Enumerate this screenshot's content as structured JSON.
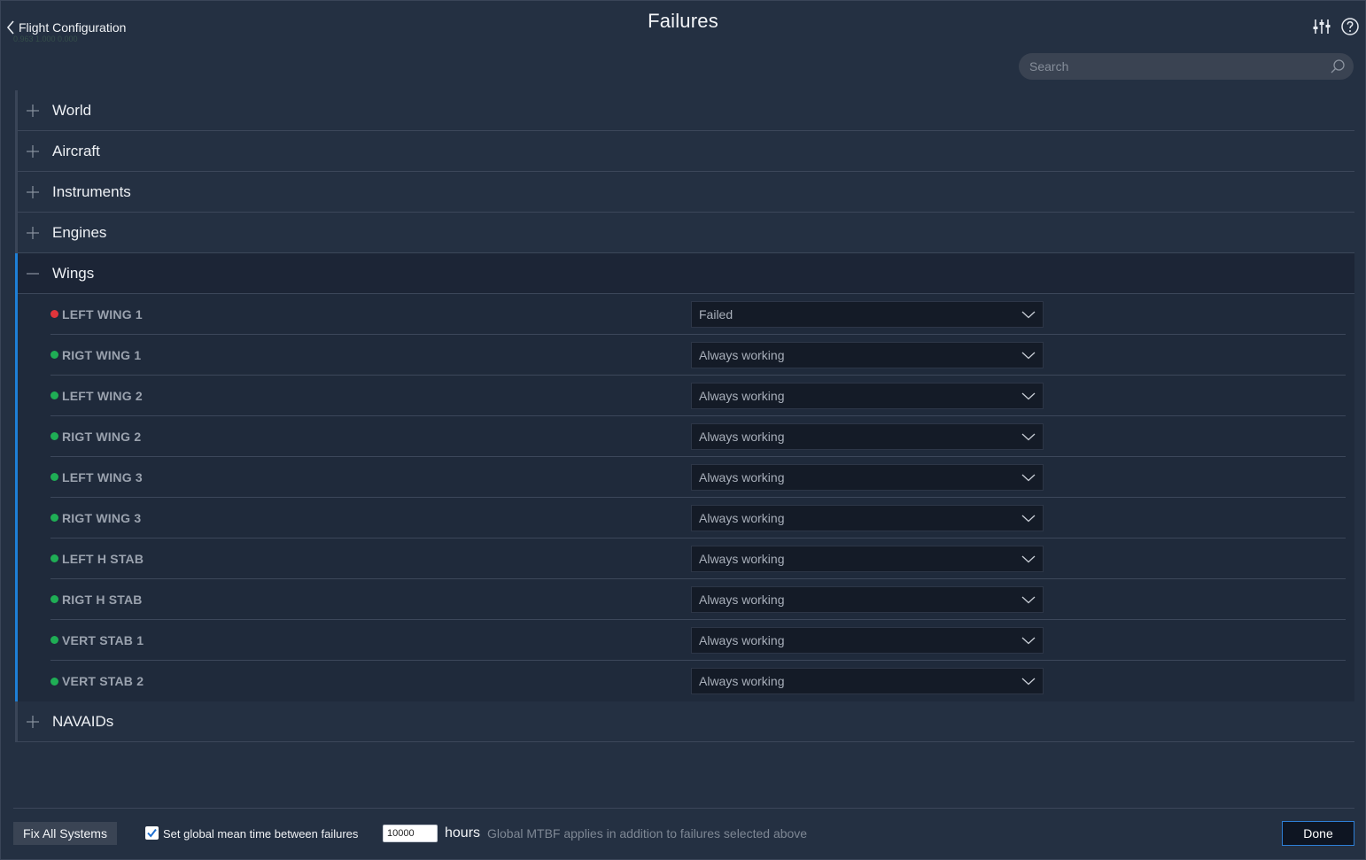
{
  "header": {
    "back_label": "Flight Configuration",
    "title": "Failures",
    "filter_icon": "sliders-icon",
    "help_icon": "help-circle-icon",
    "ghost_text": "0.963 1.000 0.000"
  },
  "search": {
    "placeholder": "Search",
    "value": "",
    "icon": "search-icon"
  },
  "categories_top": [
    {
      "label": "World",
      "expanded": false
    },
    {
      "label": "Aircraft",
      "expanded": false
    },
    {
      "label": "Instruments",
      "expanded": false
    },
    {
      "label": "Engines",
      "expanded": false
    }
  ],
  "wings": {
    "label": "Wings",
    "expanded": true,
    "items": [
      {
        "name": "LEFT WING 1",
        "status": "Failed",
        "status_color": "#e0353b"
      },
      {
        "name": "RIGT WING 1",
        "status": "Always working",
        "status_color": "#1fae55"
      },
      {
        "name": "LEFT WING 2",
        "status": "Always working",
        "status_color": "#1fae55"
      },
      {
        "name": "RIGT WING 2",
        "status": "Always working",
        "status_color": "#1fae55"
      },
      {
        "name": "LEFT WING 3",
        "status": "Always working",
        "status_color": "#1fae55"
      },
      {
        "name": "RIGT WING 3",
        "status": "Always working",
        "status_color": "#1fae55"
      },
      {
        "name": "LEFT H STAB",
        "status": "Always working",
        "status_color": "#1fae55"
      },
      {
        "name": "RIGT H STAB",
        "status": "Always working",
        "status_color": "#1fae55"
      },
      {
        "name": "VERT STAB 1",
        "status": "Always working",
        "status_color": "#1fae55"
      },
      {
        "name": "VERT STAB 2",
        "status": "Always working",
        "status_color": "#1fae55"
      }
    ]
  },
  "categories_bottom": [
    {
      "label": "NAVAIDs",
      "expanded": false
    }
  ],
  "footer": {
    "fix_all_label": "Fix All Systems",
    "global_mtbf_checked": true,
    "global_mtbf_label": "Set global mean time between failures",
    "mtbf_value": "10000",
    "hours_label": "hours",
    "mtbf_note": "Global MTBF applies in addition to failures selected above",
    "done_label": "Done"
  },
  "colors": {
    "accent": "#1e7fd6",
    "failed": "#e0353b",
    "working": "#1fae55",
    "panel": "#243042"
  }
}
